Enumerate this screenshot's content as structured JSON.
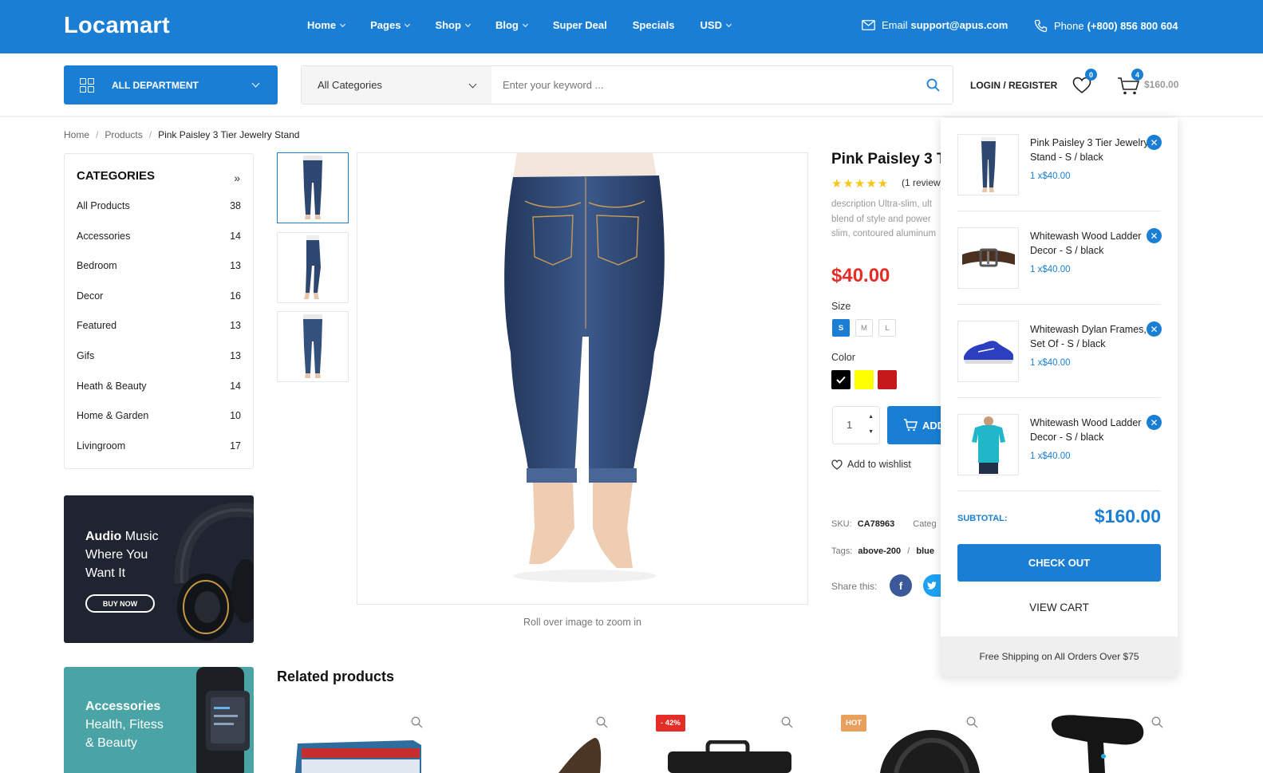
{
  "header": {
    "logo": "Locamart",
    "nav": [
      {
        "label": "Home",
        "dropdown": true
      },
      {
        "label": "Pages",
        "dropdown": true
      },
      {
        "label": "Shop",
        "dropdown": true
      },
      {
        "label": "Blog",
        "dropdown": true
      },
      {
        "label": "Super Deal",
        "dropdown": false
      },
      {
        "label": "Specials",
        "dropdown": false
      },
      {
        "label": "USD",
        "dropdown": true
      }
    ],
    "email_label": "Email",
    "email": "support@apus.com",
    "phone_label": "Phone",
    "phone": "(+800) 856 800 604"
  },
  "searchbar": {
    "department_label": "ALL DEPARTMENT",
    "category_selected": "All Categories",
    "placeholder": "Enter your keyword ..."
  },
  "account": {
    "login": "LOGIN / REGISTER",
    "wishlist_count": "0",
    "cart_count": "4",
    "cart_total": "$160.00"
  },
  "breadcrumb": {
    "items": [
      "Home",
      "Products",
      "Pink Paisley 3 Tier Jewelry Stand"
    ],
    "separator": "/"
  },
  "categories": {
    "title": "CATEGORIES",
    "items": [
      {
        "name": "All Products",
        "count": "38"
      },
      {
        "name": "Accessories",
        "count": "14"
      },
      {
        "name": "Bedroom",
        "count": "13"
      },
      {
        "name": "Decor",
        "count": "16"
      },
      {
        "name": "Featured",
        "count": "13"
      },
      {
        "name": "Gifs",
        "count": "13"
      },
      {
        "name": "Heath & Beauty",
        "count": "14"
      },
      {
        "name": "Home & Garden",
        "count": "10"
      },
      {
        "name": "Livingroom",
        "count": "17"
      }
    ]
  },
  "banners": [
    {
      "bold": "Audio",
      "rest1": " Music",
      "line2": "Where You",
      "line3": "Want It",
      "button": "BUY NOW"
    },
    {
      "bold": "Accessories",
      "line2": "Health, Fitess",
      "line3": "& Beauty"
    }
  ],
  "gallery": {
    "zoom_hint": "Roll over image to zoom in"
  },
  "product": {
    "title": "Pink Paisley 3 T",
    "rating": 5,
    "stars": "★★★★★",
    "review": "(1 review)",
    "description": "description Ultra-slim, ult blend of style and power slim, contoured aluminum",
    "price": "$40.00",
    "size_label": "Size",
    "sizes": [
      "S",
      "M",
      "L"
    ],
    "selected_size": "S",
    "color_label": "Color",
    "colors": [
      "#000000",
      "#ffff00",
      "#c41a1a"
    ],
    "quantity": "1",
    "add_to_cart": "ADD",
    "wishlist": "Add to wishlist",
    "sku_label": "SKU:",
    "sku": "CA78963",
    "category_label": "Categ",
    "tags_label": "Tags:",
    "tag1": "above-200",
    "tag_sep": "/",
    "tag2": "blue",
    "share_label": "Share this:"
  },
  "related": {
    "title": "Related products",
    "badges": [
      "- 42%",
      "HOT"
    ]
  },
  "minicart": {
    "items": [
      {
        "name": "Pink Paisley 3 Tier Jewelry Stand - S / black",
        "qty": "1 x$40.00"
      },
      {
        "name": "Whitewash Wood Ladder Decor - S / black",
        "qty": "1 x$40.00"
      },
      {
        "name": "Whitewash Dylan Frames, Set Of - S / black",
        "qty": "1 x$40.00"
      },
      {
        "name": "Whitewash Wood Ladder Decor - S / black",
        "qty": "1 x$40.00"
      }
    ],
    "subtotal_label": "SUBTOTAL:",
    "subtotal": "$160.00",
    "checkout": "CHECK OUT",
    "view_cart": "VIEW CART",
    "free_shipping": "Free Shipping on All Orders Over $75"
  },
  "colors": {
    "primary": "#1a7fd4",
    "price_red": "#e52d27"
  }
}
